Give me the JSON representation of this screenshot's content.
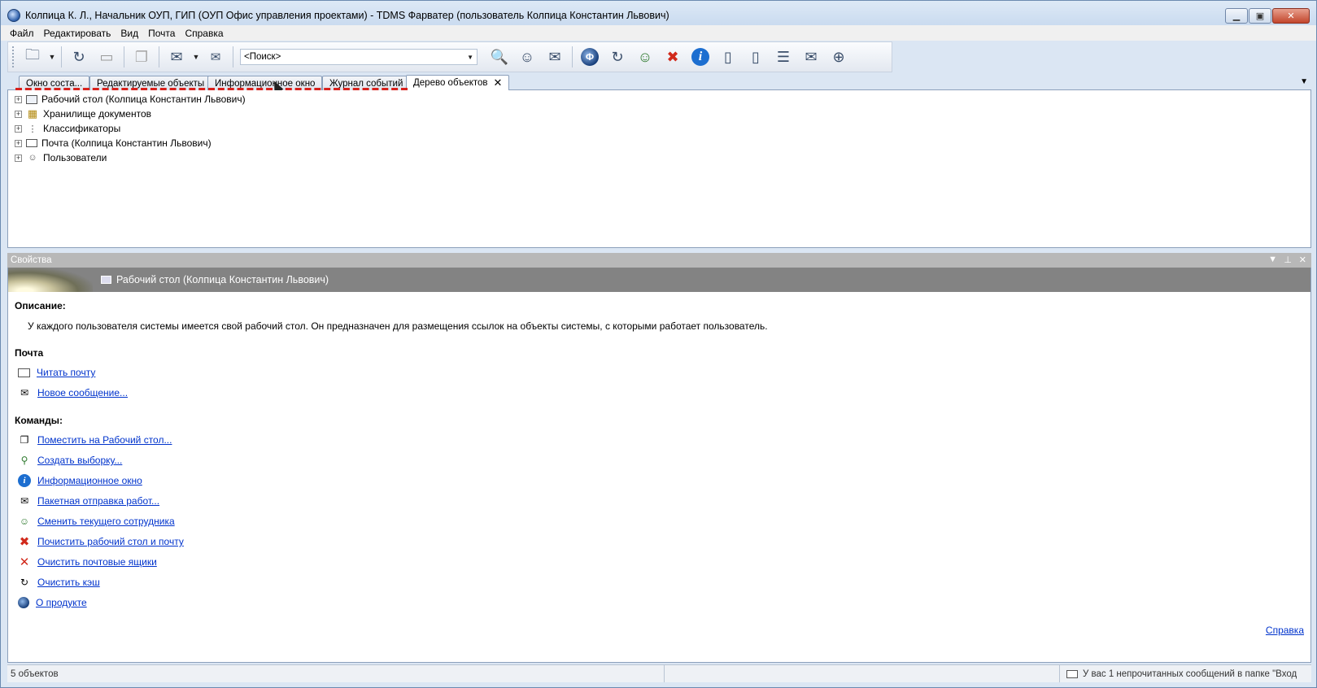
{
  "window": {
    "title": "Колпица К. Л., Начальник ОУП, ГИП (ОУП Офис управления проектами) - TDMS Фарватер (пользователь Колпица Константин Львович)"
  },
  "menu": [
    "Файл",
    "Редактировать",
    "Вид",
    "Почта",
    "Справка"
  ],
  "toolbar": {
    "search_placeholder": "<Поиск>"
  },
  "tabs": [
    {
      "label": "Окно состa...",
      "active": false
    },
    {
      "label": "Редактируемые объекты",
      "active": false
    },
    {
      "label": "Информационное окно",
      "active": false
    },
    {
      "label": "Журнал событий",
      "active": false
    },
    {
      "label": "Дерево объектов",
      "active": true
    }
  ],
  "tree": [
    {
      "label": "Рабочий стол (Колпица Константин Львович)",
      "icon": "desktop-icon"
    },
    {
      "label": "Хранилище документов",
      "icon": "storage-icon"
    },
    {
      "label": "Классификаторы",
      "icon": "classifier-icon"
    },
    {
      "label": "Почта (Колпица Константин Львович)",
      "icon": "mail-icon"
    },
    {
      "label": "Пользователи",
      "icon": "users-icon"
    }
  ],
  "properties": {
    "header": "Свойства",
    "banner_title": "Рабочий стол (Колпица Константин Львович)",
    "description_title": "Описание:",
    "description": "У каждого пользователя системы имеется свой рабочий стол. Он предназначен для размещения ссылок на объекты системы, с которыми работает пользователь.",
    "mail_title": "Почта",
    "mail_links": [
      "Читать почту",
      "Новое сообщение..."
    ],
    "commands_title": "Команды:",
    "commands": [
      "Поместить на Рабочий стол...",
      "Создать выборку...",
      "Информационное окно",
      "Пакетная отправка работ...",
      "Сменить текущего сотрудника",
      "Почистить рабочий стол и почту",
      "Очистить почтовые ящики",
      "Очистить кэш",
      "О продукте"
    ],
    "help_link": "Справка"
  },
  "status": {
    "count": "5 объектов",
    "message": "У вас 1 непрочитанных сообщений в папке \"Вход"
  }
}
